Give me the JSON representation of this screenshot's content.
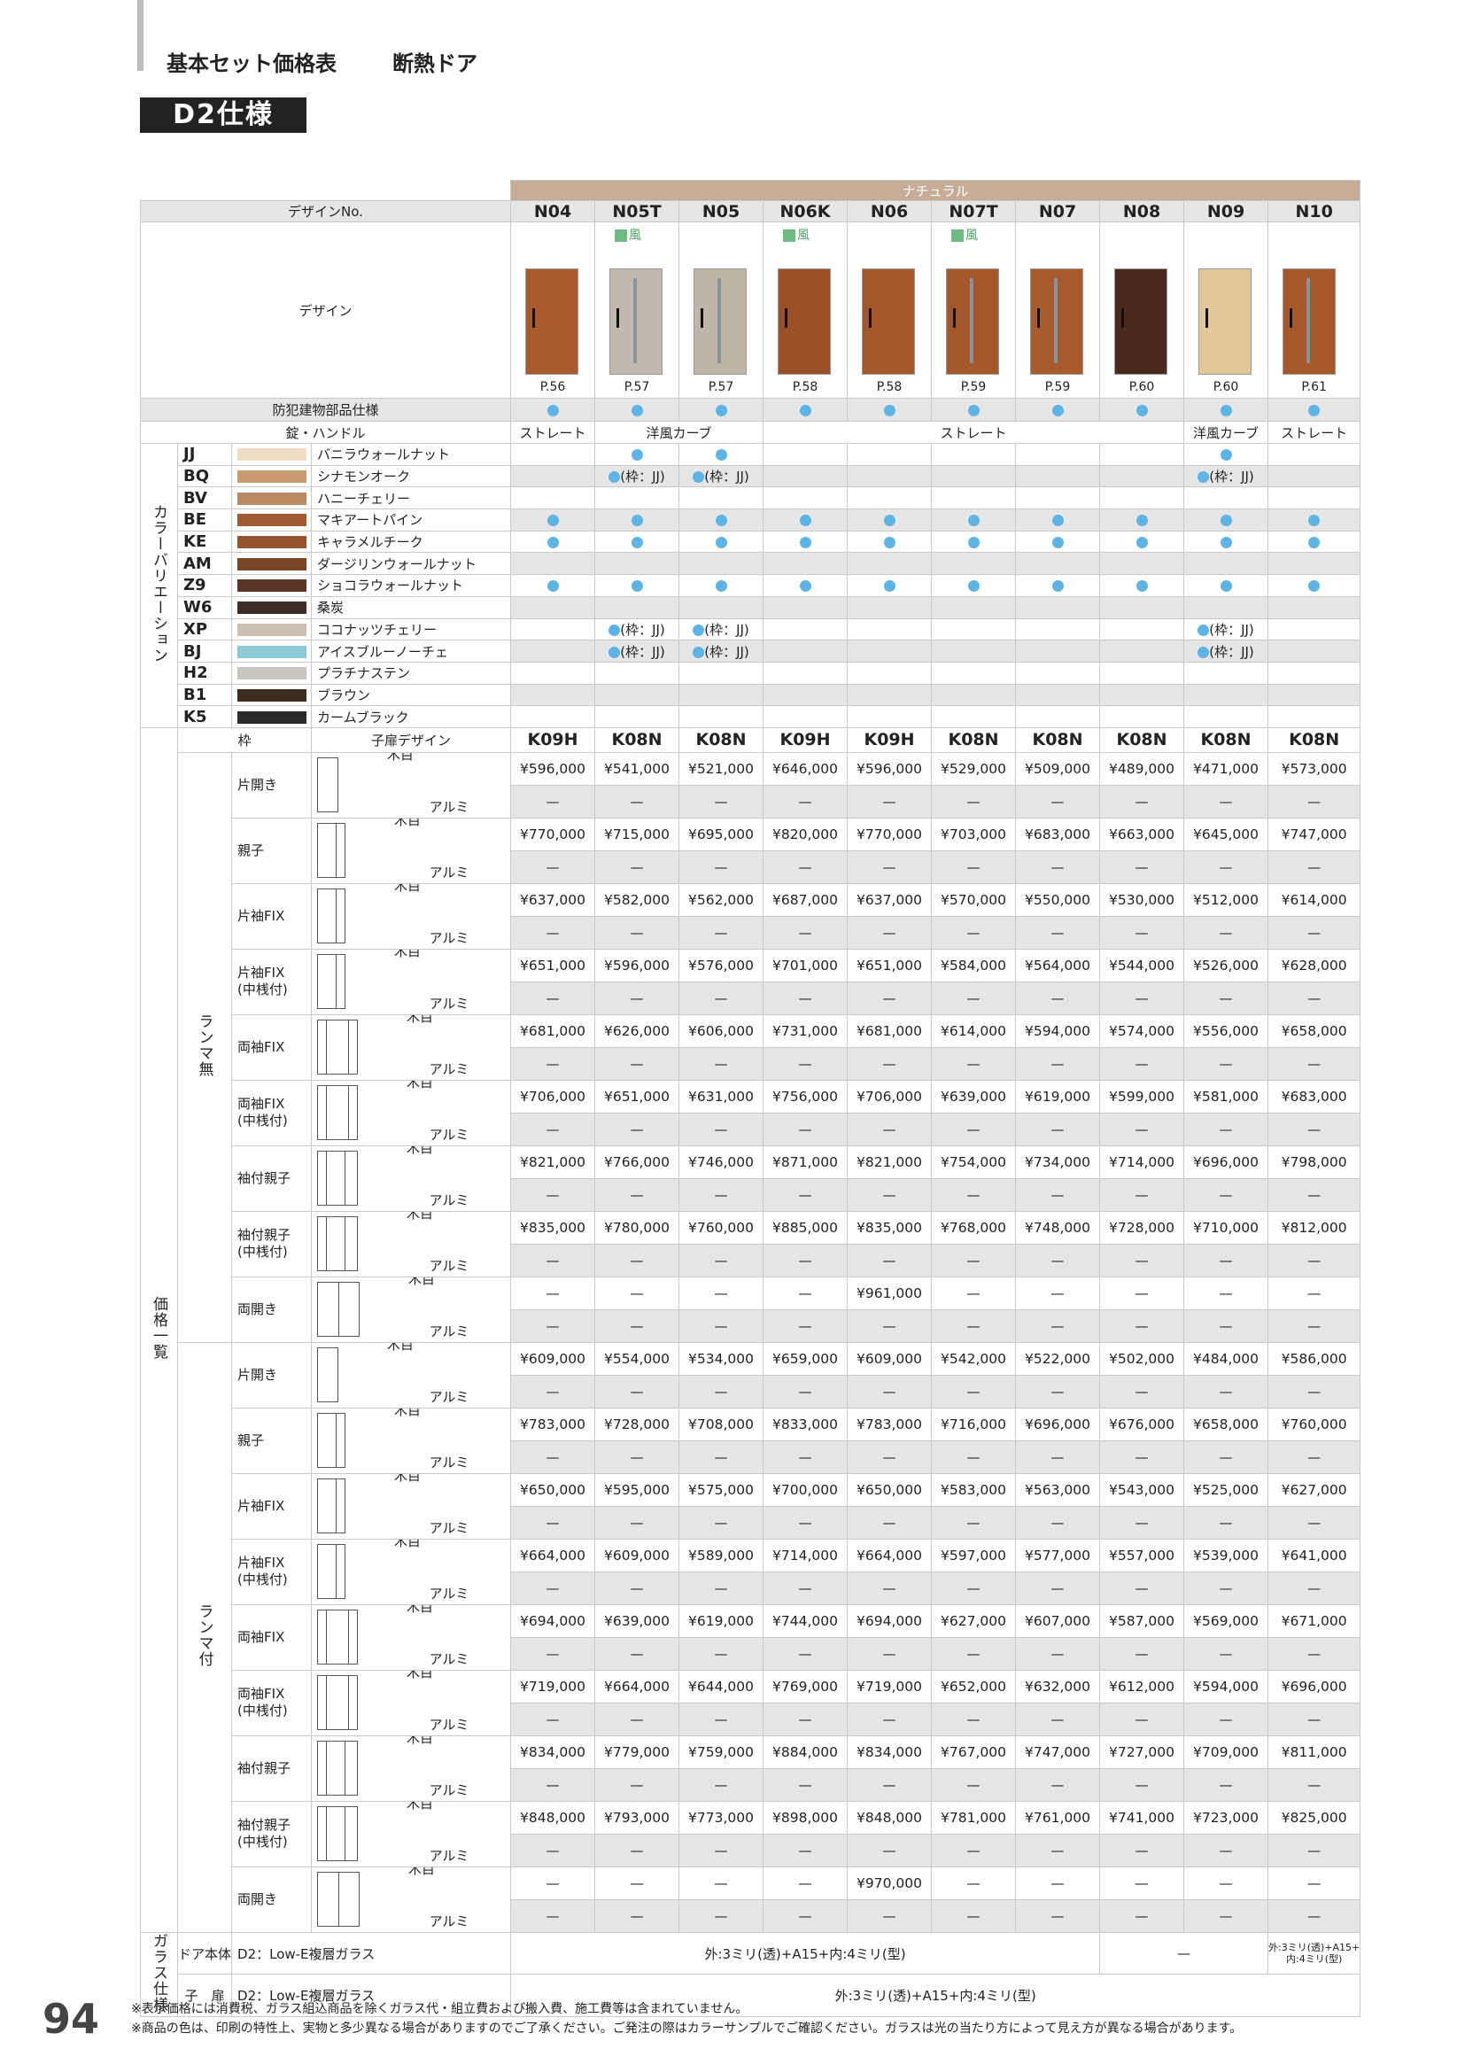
{
  "header": {
    "title": "基本セット価格表",
    "subtitle": "断熱ドア",
    "spec": "D2仕様"
  },
  "natural_label": "ナチュラル",
  "labels": {
    "design_no": "デザインNo.",
    "design": "デザイン",
    "bouhan": "防犯建物部品仕様",
    "lock": "錠・ハンドル",
    "color_variation": "カラーバリエーション",
    "frame": "枠",
    "child_design": "子扉デザイン",
    "price_list": "価格一覧",
    "ranma_none": "ランマ無",
    "ranma_with": "ランマ付",
    "wood": "木目",
    "alumi": "アルミ",
    "glass_spec": "ガラス仕様",
    "door_body": "ドア本体",
    "child_door": "子　扉",
    "glass_type": "D2：Low-E複層ガラス",
    "wind_mark": "風",
    "dash": "—"
  },
  "designs": [
    {
      "code": "N04",
      "page": "P.56",
      "wind": false,
      "frame": "K09H",
      "slit": false,
      "color": "#a85a2c"
    },
    {
      "code": "N05T",
      "page": "P.57",
      "wind": true,
      "frame": "K08N",
      "slit": true,
      "color": "#c1b9ad"
    },
    {
      "code": "N05",
      "page": "P.57",
      "wind": false,
      "frame": "K08N",
      "slit": true,
      "color": "#bdb5a8"
    },
    {
      "code": "N06K",
      "page": "P.58",
      "wind": true,
      "frame": "K09H",
      "slit": false,
      "color": "#9a5128"
    },
    {
      "code": "N06",
      "page": "P.58",
      "wind": false,
      "frame": "K09H",
      "slit": false,
      "color": "#a3572b"
    },
    {
      "code": "N07T",
      "page": "P.59",
      "wind": true,
      "frame": "K08N",
      "slit": true,
      "color": "#a4572b"
    },
    {
      "code": "N07",
      "page": "P.59",
      "wind": false,
      "frame": "K08N",
      "slit": true,
      "color": "#a85b2e"
    },
    {
      "code": "N08",
      "page": "P.60",
      "wind": false,
      "frame": "K08N",
      "slit": false,
      "color": "#4a2a1c"
    },
    {
      "code": "N09",
      "page": "P.60",
      "wind": false,
      "frame": "K08N",
      "slit": false,
      "color": "#e3c69a"
    },
    {
      "code": "N10",
      "page": "P.61",
      "wind": false,
      "frame": "K08N",
      "slit": true,
      "color": "#a6582b"
    }
  ],
  "lock_cells": [
    {
      "text": "ストレート",
      "span": 1
    },
    {
      "text": "洋風カーブ",
      "span": 2
    },
    {
      "text": "ストレート",
      "span": 5
    },
    {
      "text": "洋風カーブ",
      "span": 1
    },
    {
      "text": "ストレート",
      "span": 1
    }
  ],
  "colors": [
    {
      "code": "JJ",
      "name": "バニラウォールナット",
      "swatch": "#efdcc4",
      "avail": [
        "",
        "dot",
        "dot",
        "",
        "",
        "",
        "",
        "",
        "dot",
        ""
      ]
    },
    {
      "code": "BQ",
      "name": "シナモンオーク",
      "swatch": "#c79b6e",
      "avail": [
        "",
        "dotjj",
        "dotjj",
        "",
        "",
        "",
        "",
        "",
        "dotjj",
        ""
      ]
    },
    {
      "code": "BV",
      "name": "ハニーチェリー",
      "swatch": "#b98a62",
      "avail": [
        "",
        "",
        "",
        "",
        "",
        "",
        "",
        "",
        "",
        ""
      ]
    },
    {
      "code": "BE",
      "name": "マキアートパイン",
      "swatch": "#a25a32",
      "avail": [
        "dot",
        "dot",
        "dot",
        "dot",
        "dot",
        "dot",
        "dot",
        "dot",
        "dot",
        "dot"
      ]
    },
    {
      "code": "KE",
      "name": "キャラメルチーク",
      "swatch": "#95542e",
      "avail": [
        "dot",
        "dot",
        "dot",
        "dot",
        "dot",
        "dot",
        "dot",
        "dot",
        "dot",
        "dot"
      ]
    },
    {
      "code": "AM",
      "name": "ダージリンウォールナット",
      "swatch": "#7a4527",
      "avail": [
        "",
        "",
        "",
        "",
        "",
        "",
        "",
        "",
        "",
        ""
      ]
    },
    {
      "code": "Z9",
      "name": "ショコラウォールナット",
      "swatch": "#5a3424",
      "avail": [
        "dot",
        "dot",
        "dot",
        "dot",
        "dot",
        "dot",
        "dot",
        "dot",
        "dot",
        "dot"
      ]
    },
    {
      "code": "W6",
      "name": "桑炭",
      "swatch": "#3d2e28",
      "avail": [
        "",
        "",
        "",
        "",
        "",
        "",
        "",
        "",
        "",
        ""
      ]
    },
    {
      "code": "XP",
      "name": "ココナッツチェリー",
      "swatch": "#cbbfb3",
      "avail": [
        "",
        "dotjj",
        "dotjj",
        "",
        "",
        "",
        "",
        "",
        "dotjj",
        ""
      ]
    },
    {
      "code": "BJ",
      "name": "アイスブルーノーチェ",
      "swatch": "#8ec9d7",
      "avail": [
        "",
        "dotjj",
        "dotjj",
        "",
        "",
        "",
        "",
        "",
        "dotjj",
        ""
      ]
    },
    {
      "code": "H2",
      "name": "プラチナステン",
      "swatch": "#c8c4be",
      "avail": [
        "",
        "",
        "",
        "",
        "",
        "",
        "",
        "",
        "",
        ""
      ]
    },
    {
      "code": "B1",
      "name": "ブラウン",
      "swatch": "#3e2c23",
      "avail": [
        "",
        "",
        "",
        "",
        "",
        "",
        "",
        "",
        "",
        ""
      ]
    },
    {
      "code": "K5",
      "name": "カームブラック",
      "swatch": "#2b2b2b",
      "avail": [
        "",
        "",
        "",
        "",
        "",
        "",
        "",
        "",
        "",
        ""
      ]
    }
  ],
  "jj_note": "(枠：JJ)",
  "price_groups": [
    {
      "label": "ランマ無",
      "rows": [
        {
          "type": "片開き",
          "icon": "single",
          "wood": [
            "¥596,000",
            "¥541,000",
            "¥521,000",
            "¥646,000",
            "¥596,000",
            "¥529,000",
            "¥509,000",
            "¥489,000",
            "¥471,000",
            "¥573,000"
          ]
        },
        {
          "type": "親子",
          "icon": "oyako",
          "wood": [
            "¥770,000",
            "¥715,000",
            "¥695,000",
            "¥820,000",
            "¥770,000",
            "¥703,000",
            "¥683,000",
            "¥663,000",
            "¥645,000",
            "¥747,000"
          ]
        },
        {
          "type": "片袖FIX",
          "icon": "katasode",
          "wood": [
            "¥637,000",
            "¥582,000",
            "¥562,000",
            "¥687,000",
            "¥637,000",
            "¥570,000",
            "¥550,000",
            "¥530,000",
            "¥512,000",
            "¥614,000"
          ]
        },
        {
          "type": "片袖FIX\n(中桟付)",
          "icon": "katasode2",
          "wood": [
            "¥651,000",
            "¥596,000",
            "¥576,000",
            "¥701,000",
            "¥651,000",
            "¥584,000",
            "¥564,000",
            "¥544,000",
            "¥526,000",
            "¥628,000"
          ]
        },
        {
          "type": "両袖FIX",
          "icon": "ryosode",
          "wood": [
            "¥681,000",
            "¥626,000",
            "¥606,000",
            "¥731,000",
            "¥681,000",
            "¥614,000",
            "¥594,000",
            "¥574,000",
            "¥556,000",
            "¥658,000"
          ]
        },
        {
          "type": "両袖FIX\n(中桟付)",
          "icon": "ryosode2",
          "wood": [
            "¥706,000",
            "¥651,000",
            "¥631,000",
            "¥756,000",
            "¥706,000",
            "¥639,000",
            "¥619,000",
            "¥599,000",
            "¥581,000",
            "¥683,000"
          ]
        },
        {
          "type": "袖付親子",
          "icon": "sodeoyako",
          "wood": [
            "¥821,000",
            "¥766,000",
            "¥746,000",
            "¥871,000",
            "¥821,000",
            "¥754,000",
            "¥734,000",
            "¥714,000",
            "¥696,000",
            "¥798,000"
          ]
        },
        {
          "type": "袖付親子\n(中桟付)",
          "icon": "sodeoyako2",
          "wood": [
            "¥835,000",
            "¥780,000",
            "¥760,000",
            "¥885,000",
            "¥835,000",
            "¥768,000",
            "¥748,000",
            "¥728,000",
            "¥710,000",
            "¥812,000"
          ]
        },
        {
          "type": "両開き",
          "icon": "ryobiraki",
          "wood": [
            "—",
            "—",
            "—",
            "—",
            "¥961,000",
            "—",
            "—",
            "—",
            "—",
            "—"
          ]
        }
      ]
    },
    {
      "label": "ランマ付",
      "rows": [
        {
          "type": "片開き",
          "icon": "single",
          "wood": [
            "¥609,000",
            "¥554,000",
            "¥534,000",
            "¥659,000",
            "¥609,000",
            "¥542,000",
            "¥522,000",
            "¥502,000",
            "¥484,000",
            "¥586,000"
          ]
        },
        {
          "type": "親子",
          "icon": "oyako",
          "wood": [
            "¥783,000",
            "¥728,000",
            "¥708,000",
            "¥833,000",
            "¥783,000",
            "¥716,000",
            "¥696,000",
            "¥676,000",
            "¥658,000",
            "¥760,000"
          ]
        },
        {
          "type": "片袖FIX",
          "icon": "katasode",
          "wood": [
            "¥650,000",
            "¥595,000",
            "¥575,000",
            "¥700,000",
            "¥650,000",
            "¥583,000",
            "¥563,000",
            "¥543,000",
            "¥525,000",
            "¥627,000"
          ]
        },
        {
          "type": "片袖FIX\n(中桟付)",
          "icon": "katasode2",
          "wood": [
            "¥664,000",
            "¥609,000",
            "¥589,000",
            "¥714,000",
            "¥664,000",
            "¥597,000",
            "¥577,000",
            "¥557,000",
            "¥539,000",
            "¥641,000"
          ]
        },
        {
          "type": "両袖FIX",
          "icon": "ryosode",
          "wood": [
            "¥694,000",
            "¥639,000",
            "¥619,000",
            "¥744,000",
            "¥694,000",
            "¥627,000",
            "¥607,000",
            "¥587,000",
            "¥569,000",
            "¥671,000"
          ]
        },
        {
          "type": "両袖FIX\n(中桟付)",
          "icon": "ryosode2",
          "wood": [
            "¥719,000",
            "¥664,000",
            "¥644,000",
            "¥769,000",
            "¥719,000",
            "¥652,000",
            "¥632,000",
            "¥612,000",
            "¥594,000",
            "¥696,000"
          ]
        },
        {
          "type": "袖付親子",
          "icon": "sodeoyako",
          "wood": [
            "¥834,000",
            "¥779,000",
            "¥759,000",
            "¥884,000",
            "¥834,000",
            "¥767,000",
            "¥747,000",
            "¥727,000",
            "¥709,000",
            "¥811,000"
          ]
        },
        {
          "type": "袖付親子\n(中桟付)",
          "icon": "sodeoyako2",
          "wood": [
            "¥848,000",
            "¥793,000",
            "¥773,000",
            "¥898,000",
            "¥848,000",
            "¥781,000",
            "¥761,000",
            "¥741,000",
            "¥723,000",
            "¥825,000"
          ]
        },
        {
          "type": "両開き",
          "icon": "ryobiraki",
          "wood": [
            "—",
            "—",
            "—",
            "—",
            "¥970,000",
            "—",
            "—",
            "—",
            "—",
            "—"
          ]
        }
      ]
    }
  ],
  "glass": {
    "body_main": "外:3ミリ(透)+A15+内:4ミリ(型)",
    "body_dash": "—",
    "body_n10_line1": "外:3ミリ(透)+A15+",
    "body_n10_line2": "内:4ミリ(型)",
    "child": "外:3ミリ(透)+A15+内:4ミリ(型)"
  },
  "page_number": "94",
  "notes": [
    "※表示価格には消費税、ガラス組込商品を除くガラス代・組立費および搬入費、施工費等は含まれていません。",
    "※商品の色は、印刷の特性上、実物と多少異なる場合がありますのでご了承ください。ご発注の際はカラーサンプルでご確認ください。ガラスは光の当たり方によって見え方が異なる場合があります。"
  ]
}
